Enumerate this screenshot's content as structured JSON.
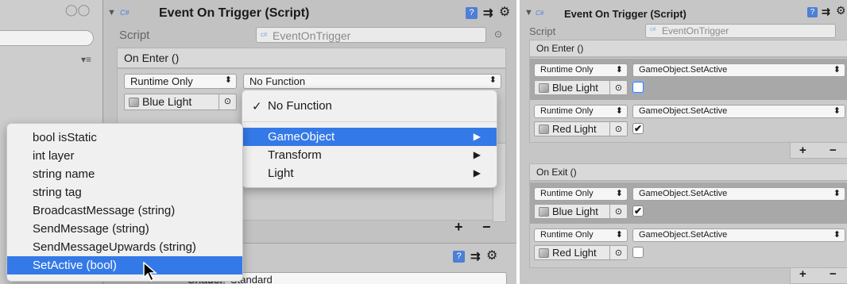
{
  "left": {
    "header_title": "Event On Trigger (Script)",
    "script_label": "Script",
    "script_value": "EventOnTrigger",
    "event_label": "On Enter ()",
    "runtime_value": "Runtime Only",
    "function_value": "No Function",
    "object_value": "Blue Light",
    "second_component_shader_label": "Shader",
    "second_component_shader_value": "Standard",
    "function_menu": {
      "items": [
        {
          "label": "No Function",
          "checked": true
        },
        {
          "label": "GameObject",
          "submenu": true,
          "selected": true
        },
        {
          "label": "Transform",
          "submenu": true
        },
        {
          "label": "Light",
          "submenu": true
        }
      ],
      "check_glyph": "✓"
    },
    "gameobject_submenu": {
      "items": [
        "bool isStatic",
        "int layer",
        "string name",
        "string tag",
        "BroadcastMessage (string)",
        "SendMessage (string)",
        "SendMessageUpwards (string)",
        "SetActive (bool)"
      ],
      "selected_index": 7
    }
  },
  "right": {
    "header_title": "Event On Trigger (Script)",
    "script_label": "Script",
    "script_value": "EventOnTrigger",
    "on_enter": {
      "label": "On Enter ()",
      "entries": [
        {
          "runtime": "Runtime Only",
          "function": "GameObject.SetActive",
          "object": "Blue Light",
          "checked": false
        },
        {
          "runtime": "Runtime Only",
          "function": "GameObject.SetActive",
          "object": "Red Light",
          "checked": true
        }
      ]
    },
    "on_exit": {
      "label": "On Exit ()",
      "entries": [
        {
          "runtime": "Runtime Only",
          "function": "GameObject.SetActive",
          "object": "Blue Light",
          "checked": true
        },
        {
          "runtime": "Runtime Only",
          "function": "GameObject.SetActive",
          "object": "Red Light",
          "checked": false
        }
      ]
    },
    "plus": "+",
    "minus": "−"
  },
  "glyphs": {
    "script_icon": "C#",
    "help": "?",
    "settings": "⚙",
    "collapse": "▼",
    "dd_arrow": "⬍",
    "picker": "⊙",
    "check": "✔",
    "submenu": "▶"
  },
  "colors": {
    "menu_highlight": "#3479e8",
    "panel_bg": "#c2c2c2"
  }
}
